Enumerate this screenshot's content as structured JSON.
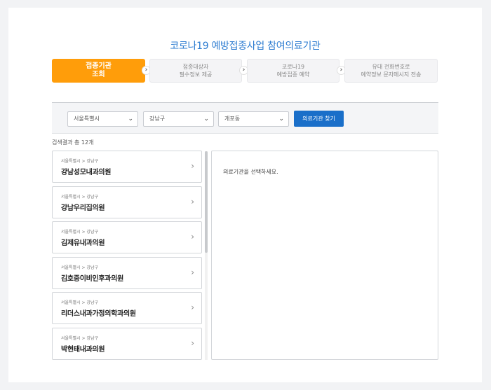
{
  "header": {
    "title_main": "코로나19 예방접종사업 ",
    "title_accent": "참여의료기관"
  },
  "steps": [
    {
      "line1": "접종기관",
      "line2": "조회",
      "active": true
    },
    {
      "line1": "접종대상자",
      "line2": "필수정보 제공",
      "active": false
    },
    {
      "line1": "코로나19",
      "line2": "예방접종 예약",
      "active": false
    },
    {
      "line1": "유대 전화번호로",
      "line2": "예약정보 문자메시지 전송",
      "active": false
    }
  ],
  "step_arrow_glyph": "›",
  "filters": {
    "city": "서울특별시",
    "district": "강남구",
    "dong": "개포동",
    "search_button": "의료기관 찾기"
  },
  "results": {
    "count_text": "검색결과 총 12개",
    "items": [
      {
        "region": "서울특별시 > 강남구",
        "name": "강남성모내과의원"
      },
      {
        "region": "서울특별시 > 강남구",
        "name": "강남우리집의원"
      },
      {
        "region": "서울특별시 > 강남구",
        "name": "김제유내과의원"
      },
      {
        "region": "서울특별시 > 강남구",
        "name": "김호중이비인후과의원"
      },
      {
        "region": "서울특별시 > 강남구",
        "name": "리더스내과가정의학과의원"
      },
      {
        "region": "서울특별시 > 강남구",
        "name": "박현태내과의원"
      }
    ]
  },
  "detail": {
    "empty_message": "의료기관을 선택하세요."
  },
  "colors": {
    "accent_orange": "#ff9d0a",
    "primary_blue": "#1a6fc9",
    "title_blue": "#2b7bd0"
  }
}
